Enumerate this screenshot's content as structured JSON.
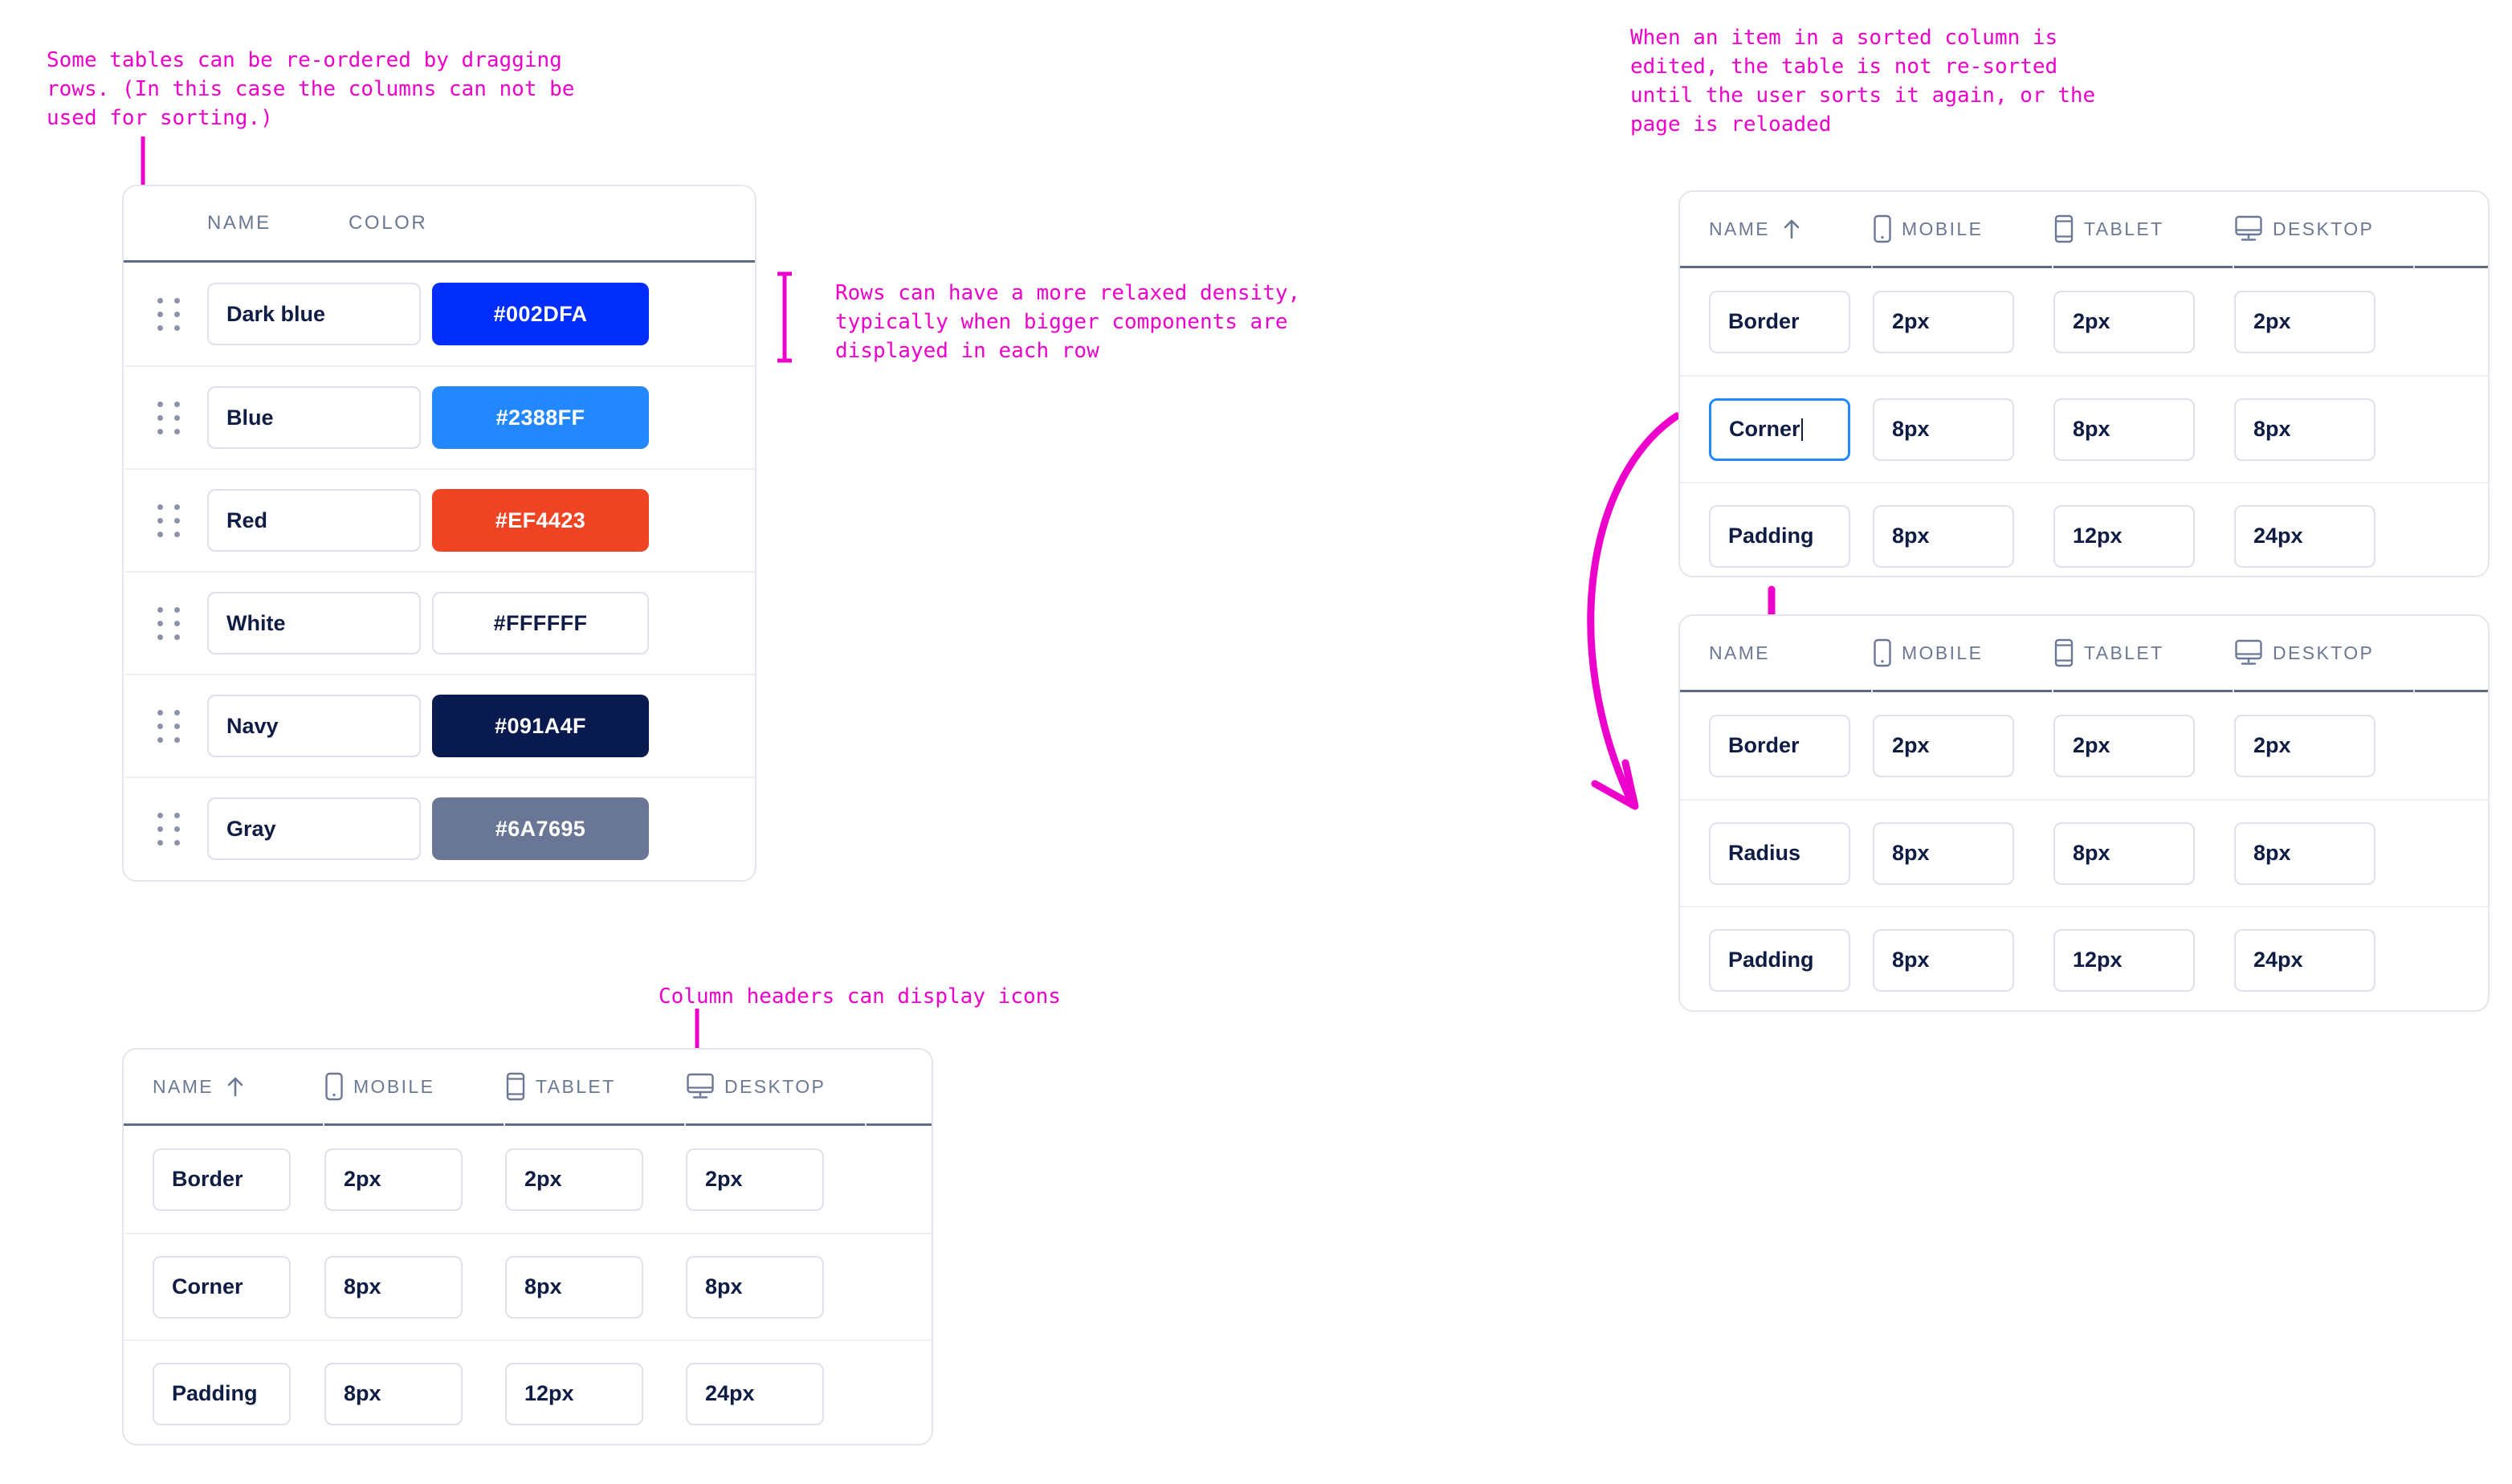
{
  "annotations": [
    {
      "id": "anno-drag-reorder",
      "text": "Some tables can be re-ordered by dragging\nrows. (In this case the columns can not be\nused for sorting.)"
    },
    {
      "id": "anno-row-density",
      "text": "Rows can have a more relaxed density,\ntypically when bigger components are\ndisplayed in each row"
    },
    {
      "id": "anno-sorted-edit",
      "text": "When an item in a sorted column is\nedited, the table is not re-sorted\nuntil the user sorts it again, or the\npage is reloaded"
    },
    {
      "id": "anno-header-icons",
      "text": "Column headers can display icons"
    }
  ],
  "annotation_color": "#EE00CC",
  "tables": {
    "colors": {
      "name": "color-tokens-table",
      "reorderable": true,
      "columns": [
        {
          "label": "NAME",
          "icon": null,
          "sorted": false
        },
        {
          "label": "COLOR",
          "icon": null,
          "sorted": false
        }
      ],
      "rows": [
        {
          "drag_handle": "drag-handle-icon",
          "name": "Dark blue",
          "color_value": "#002DFA",
          "swatch_bg": "#002DFA",
          "swatch_fg": "#FFFFFF",
          "outlined": false
        },
        {
          "drag_handle": "drag-handle-icon",
          "name": "Blue",
          "color_value": "#2388FF",
          "swatch_bg": "#2388FF",
          "swatch_fg": "#FFFFFF",
          "outlined": false
        },
        {
          "drag_handle": "drag-handle-icon",
          "name": "Red",
          "color_value": "#EF4423",
          "swatch_bg": "#EF4423",
          "swatch_fg": "#FFFFFF",
          "outlined": false
        },
        {
          "drag_handle": "drag-handle-icon",
          "name": "White",
          "color_value": "#FFFFFF",
          "swatch_bg": "#FFFFFF",
          "swatch_fg": "#0F1C44",
          "outlined": true
        },
        {
          "drag_handle": "drag-handle-icon",
          "name": "Navy",
          "color_value": "#091A4F",
          "swatch_bg": "#091A4F",
          "swatch_fg": "#FFFFFF",
          "outlined": false
        },
        {
          "drag_handle": "drag-handle-icon",
          "name": "Gray",
          "color_value": "#6A7695",
          "swatch_bg": "#6A7695",
          "swatch_fg": "#FFFFFF",
          "outlined": false
        }
      ]
    },
    "spec_bottom_left": {
      "name": "responsive-spec-table-icons",
      "columns": [
        {
          "label": "NAME",
          "icon": null,
          "sorted": true,
          "sort_direction": "asc"
        },
        {
          "label": "MOBILE",
          "icon": "mobile-icon",
          "sorted": false
        },
        {
          "label": "TABLET",
          "icon": "tablet-icon",
          "sorted": false
        },
        {
          "label": "DESKTOP",
          "icon": "desktop-icon",
          "sorted": false
        }
      ],
      "rows": [
        {
          "name": "Border",
          "mobile": "2px",
          "tablet": "2px",
          "desktop": "2px",
          "focused": false
        },
        {
          "name": "Corner",
          "mobile": "8px",
          "tablet": "8px",
          "desktop": "8px",
          "focused": false
        },
        {
          "name": "Padding",
          "mobile": "8px",
          "tablet": "12px",
          "desktop": "24px",
          "focused": false
        }
      ]
    },
    "spec_top_right": {
      "name": "responsive-spec-table-before-edit",
      "columns": [
        {
          "label": "NAME",
          "icon": null,
          "sorted": true,
          "sort_direction": "asc"
        },
        {
          "label": "MOBILE",
          "icon": "mobile-icon",
          "sorted": false
        },
        {
          "label": "TABLET",
          "icon": "tablet-icon",
          "sorted": false
        },
        {
          "label": "DESKTOP",
          "icon": "desktop-icon",
          "sorted": false
        }
      ],
      "rows": [
        {
          "name": "Border",
          "mobile": "2px",
          "tablet": "2px",
          "desktop": "2px",
          "focused": false
        },
        {
          "name": "Corner",
          "mobile": "8px",
          "tablet": "8px",
          "desktop": "8px",
          "focused": true
        },
        {
          "name": "Padding",
          "mobile": "8px",
          "tablet": "12px",
          "desktop": "24px",
          "focused": false
        }
      ]
    },
    "spec_bottom_right": {
      "name": "responsive-spec-table-after-edit",
      "columns": [
        {
          "label": "NAME",
          "icon": null,
          "sorted": false
        },
        {
          "label": "MOBILE",
          "icon": "mobile-icon",
          "sorted": false
        },
        {
          "label": "TABLET",
          "icon": "tablet-icon",
          "sorted": false
        },
        {
          "label": "DESKTOP",
          "icon": "desktop-icon",
          "sorted": false
        }
      ],
      "rows": [
        {
          "name": "Border",
          "mobile": "2px",
          "tablet": "2px",
          "desktop": "2px",
          "focused": false
        },
        {
          "name": "Radius",
          "mobile": "8px",
          "tablet": "8px",
          "desktop": "8px",
          "focused": false
        },
        {
          "name": "Padding",
          "mobile": "8px",
          "tablet": "12px",
          "desktop": "24px",
          "focused": false
        }
      ]
    }
  },
  "theme": {
    "card_border": "#E3E6EC",
    "header_rule": "#5E6B84",
    "row_rule": "#EDEFF3",
    "header_text": "#6B7894",
    "value_text": "#0F1C44",
    "field_border": "#DDE1E9",
    "focus_border": "#2388FF",
    "drag_dot": "#8C93A8"
  }
}
